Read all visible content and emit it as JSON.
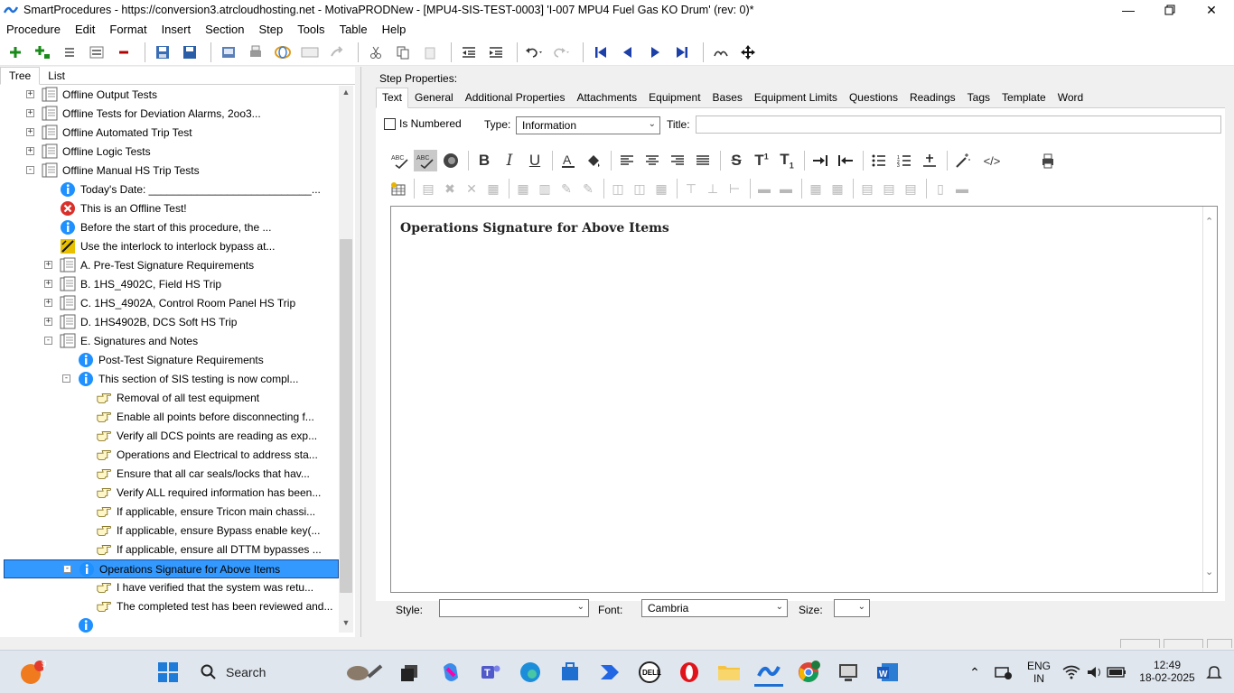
{
  "window": {
    "title": "SmartProcedures - https://conversion3.atrcloudhosting.net - MotivaPRODNew - [MPU4-SIS-TEST-0003] 'I-007 MPU4 Fuel Gas KO Drum' (rev: 0)*"
  },
  "menu": [
    "Procedure",
    "Edit",
    "Format",
    "Insert",
    "Section",
    "Step",
    "Tools",
    "Table",
    "Help"
  ],
  "left_tabs": [
    "Tree",
    "List"
  ],
  "tree": [
    {
      "label": "Offline Output Tests",
      "level": 0,
      "expander": "+",
      "icon": "section-icon"
    },
    {
      "label": "Offline Tests for Deviation Alarms, 2oo3...",
      "level": 0,
      "expander": "+",
      "icon": "section-icon"
    },
    {
      "label": "Offline Automated Trip Test",
      "level": 0,
      "expander": "+",
      "icon": "section-icon"
    },
    {
      "label": "Offline Logic Tests",
      "level": 0,
      "expander": "+",
      "icon": "section-icon"
    },
    {
      "label": "Offline Manual HS Trip Tests",
      "level": 0,
      "expander": "-",
      "icon": "section-icon"
    },
    {
      "label": "Today's Date: ___________________________...",
      "level": 1,
      "icon": "info-icon"
    },
    {
      "label": "This is an Offline Test!",
      "level": 1,
      "icon": "warning-icon"
    },
    {
      "label": "Before the start of this procedure, the ...",
      "level": 1,
      "icon": "info-icon"
    },
    {
      "label": "Use the interlock to interlock bypass at...",
      "level": 1,
      "icon": "caution-icon"
    },
    {
      "label": "A. Pre-Test Signature Requirements",
      "level": 1,
      "expander": "+",
      "icon": "section-icon"
    },
    {
      "label": "B. 1HS_4902C, Field HS Trip",
      "level": 1,
      "expander": "+",
      "icon": "section-icon"
    },
    {
      "label": "C. 1HS_4902A, Control Room Panel HS Trip",
      "level": 1,
      "expander": "+",
      "icon": "section-icon"
    },
    {
      "label": "D. 1HS4902B, DCS Soft HS Trip",
      "level": 1,
      "expander": "+",
      "icon": "section-icon"
    },
    {
      "label": "E. Signatures and Notes",
      "level": 1,
      "expander": "-",
      "icon": "section-icon"
    },
    {
      "label": "Post-Test Signature Requirements",
      "level": 2,
      "icon": "info-icon"
    },
    {
      "label": "This section of SIS testing is now compl...",
      "level": 2,
      "expander": "-",
      "icon": "info-icon"
    },
    {
      "label": "Removal of all test equipment",
      "level": 3,
      "icon": "hand-icon"
    },
    {
      "label": "Enable all points before disconnecting f...",
      "level": 3,
      "icon": "hand-icon"
    },
    {
      "label": "Verify all DCS points are reading as exp...",
      "level": 3,
      "icon": "hand-icon"
    },
    {
      "label": "Operations and Electrical to address sta...",
      "level": 3,
      "icon": "hand-icon"
    },
    {
      "label": "Ensure that all car seals/locks that hav...",
      "level": 3,
      "icon": "hand-icon"
    },
    {
      "label": "Verify ALL required information has been...",
      "level": 3,
      "icon": "hand-icon"
    },
    {
      "label": "If applicable, ensure Tricon main chassi...",
      "level": 3,
      "icon": "hand-icon"
    },
    {
      "label": "If applicable, ensure Bypass enable key(...",
      "level": 3,
      "icon": "hand-icon"
    },
    {
      "label": "If applicable, ensure all DTTM bypasses ...",
      "level": 3,
      "icon": "hand-icon"
    },
    {
      "label": "Operations Signature for Above Items",
      "level": 2,
      "expander": "-",
      "icon": "info-icon",
      "selected": true
    },
    {
      "label": "I have verified that the system was retu...",
      "level": 3,
      "icon": "hand-icon"
    },
    {
      "label": "The completed test has been reviewed and...",
      "level": 3,
      "icon": "hand-icon"
    },
    {
      "label": "",
      "level": 2,
      "icon": "info-icon"
    }
  ],
  "right": {
    "step_properties_label": "Step Properties:",
    "tabs": [
      "Text",
      "General",
      "Additional Properties",
      "Attachments",
      "Equipment",
      "Bases",
      "Equipment Limits",
      "Questions",
      "Readings",
      "Tags",
      "Template",
      "Word"
    ],
    "is_numbered_label": "Is Numbered",
    "type_label": "Type:",
    "type_value": "Information",
    "title_label": "Title:",
    "title_value": "",
    "editor_text": "Operations Signature for Above Items",
    "style_label": "Style:",
    "style_value": "",
    "font_label": "Font:",
    "font_value": "Cambria",
    "size_label": "Size:",
    "size_value": ""
  },
  "taskbar": {
    "search_label": "Search",
    "notification_count": "9",
    "language_top": "ENG",
    "language_bottom": "IN",
    "time": "12:49",
    "date": "18-02-2025"
  },
  "colors": {
    "selection": "#3399ff",
    "info_icon": "#1e90ff",
    "warning_icon": "#d9302a",
    "caution_icon": "#e8c000"
  }
}
